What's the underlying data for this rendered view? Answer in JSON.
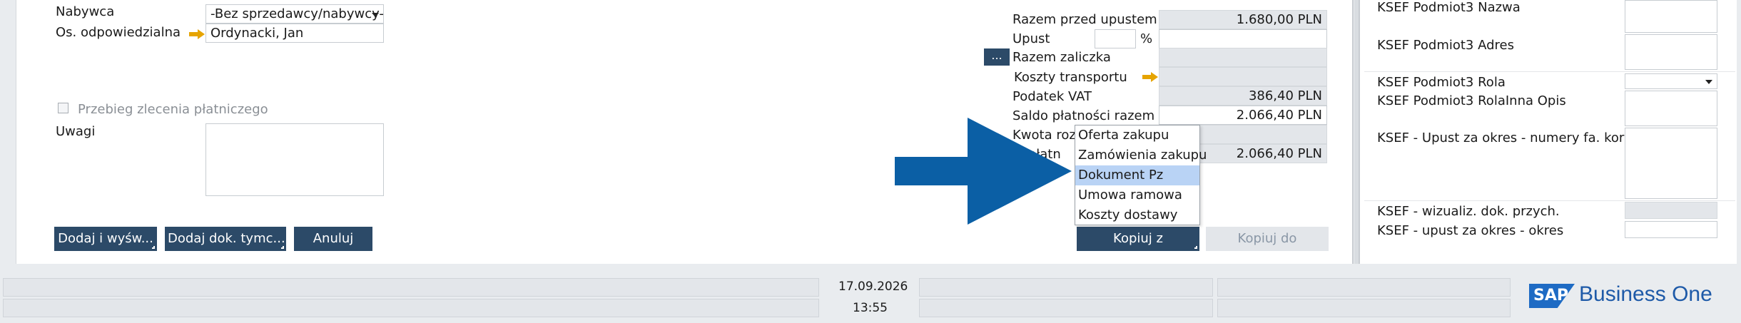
{
  "form": {
    "buyer_label": "Nabywca",
    "buyer_value": "-Bez sprzedawcy/nabywcy-",
    "responsible_label": "Os. odpowiedzialna",
    "responsible_value": "Ordynacki, Jan",
    "payment_order_label": "Przebieg zlecenia płatniczego",
    "remarks_label": "Uwagi",
    "remarks_value": ""
  },
  "totals": {
    "before_discount_label": "Razem przed upustem",
    "before_discount_value": "1.680,00 PLN",
    "discount_label": "Upust",
    "discount_pct_unit": "%",
    "ellipsis_label": "...",
    "advance_label": "Razem zaliczka",
    "transport_label": "Koszty transportu",
    "vat_label": "Podatek VAT",
    "vat_value": "386,40 PLN",
    "balance_label": "Saldo płatności razem",
    "balance_value": "2.066,40 PLN",
    "settle_label_partial": "Kwota rozlic",
    "due_label_partial": "lo płatn",
    "due_value": "2.066,40 PLN"
  },
  "buttons": {
    "add_show": "Dodaj i wyśw...",
    "add_temp": "Dodaj dok. tymc...",
    "cancel": "Anuluj",
    "copy_from": "Kopiuj z",
    "copy_to": "Kopiuj do"
  },
  "copy_from_menu": {
    "items": [
      "Oferta zakupu",
      "Zamówienia zakupu",
      "Dokument Pz",
      "Umowa ramowa",
      "Koszty dostawy"
    ],
    "selected": "Dokument Pz"
  },
  "right_panel": {
    "subject3_name": "KSEF Podmiot3 Nazwa",
    "subject3_address": "KSEF Podmiot3 Adres",
    "subject3_role": "KSEF Podmiot3 Rola",
    "subject3_role_other": "KSEF Podmiot3 RolaInna Opis",
    "discount_period_numbers": "KSEF - Upust za okres - numery fa. koryg.",
    "visualization": "KSEF - wizualiz. dok. przych.",
    "discount_period": "KSEF - upust za okres - okres"
  },
  "status_bar": {
    "date": "17.09.2026",
    "time": "13:55"
  },
  "brand": {
    "badge": "SAP",
    "product": "Business One",
    "badge_color": "#1e6bc4",
    "accent": "#0b5fa5"
  }
}
